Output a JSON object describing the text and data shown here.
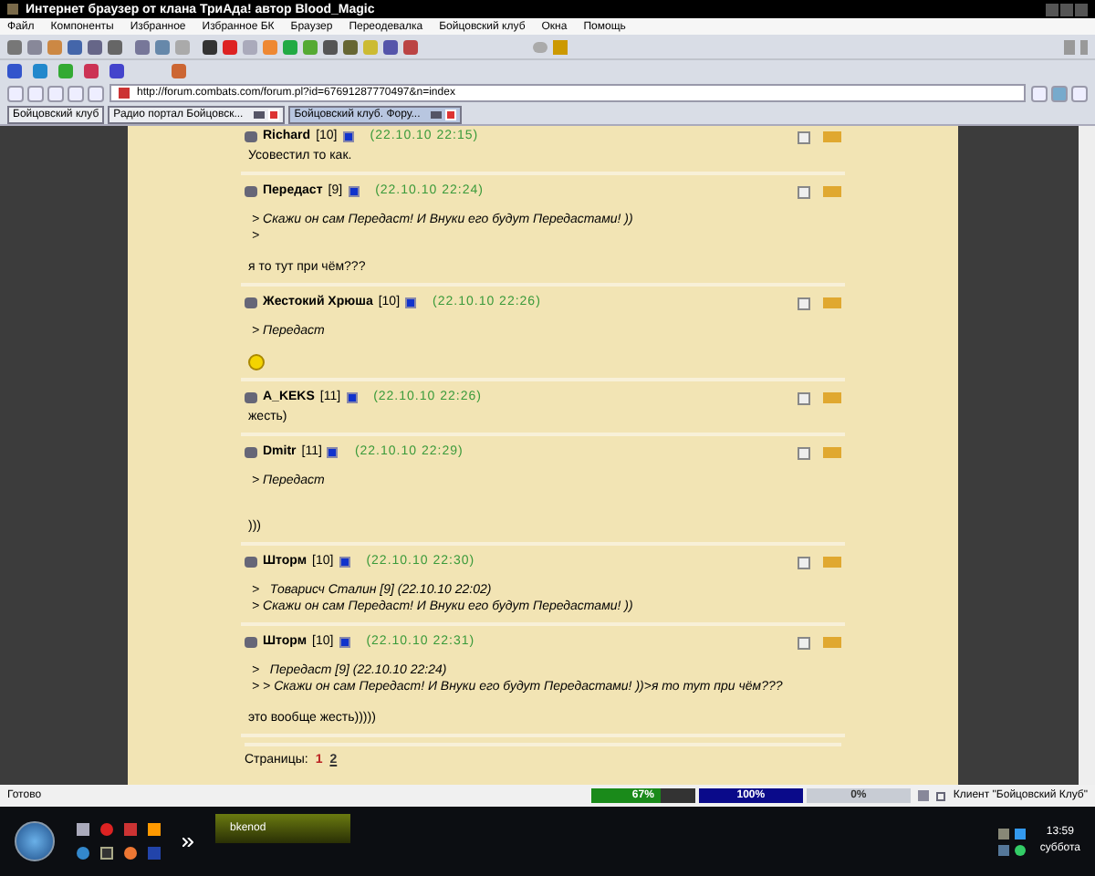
{
  "window": {
    "title": "Интернет браузер от клана ТриАда! автор Blood_Magic"
  },
  "menu": [
    "Файл",
    "Компоненты",
    "Избранное",
    "Избранное БК",
    "Браузер",
    "Переодевалка",
    "Бойцовский клуб",
    "Окна",
    "Помощь"
  ],
  "address": {
    "value": "http://forum.combats.com/forum.pl?id=67691287770497&n=index"
  },
  "tabs": [
    {
      "label": "Бойцовский клуб",
      "selected": false,
      "closable": false
    },
    {
      "label": "Радио портал Бойцовск...",
      "selected": false,
      "closable": true
    },
    {
      "label": "Бойцовский клуб. Фору...",
      "selected": true,
      "closable": true
    }
  ],
  "posts": [
    {
      "checked": false,
      "name": "Richard",
      "level": "[10]",
      "time": "(22.10.10 22:15)",
      "lines": [
        {
          "kind": "text",
          "text": "Усовестил то как."
        }
      ]
    },
    {
      "checked": false,
      "name": "Передаст",
      "level": "[9]",
      "time": "(22.10.10 22:24)",
      "lines": [
        {
          "kind": "quote",
          "text": "> Скажи он сам Передаст! И Внуки его будут Передастами! ))"
        },
        {
          "kind": "quote",
          "text": ">"
        },
        {
          "kind": "gap"
        },
        {
          "kind": "text",
          "text": "я то тут при чём???"
        }
      ]
    },
    {
      "checked": false,
      "name": "Жестокий Хрюша",
      "level": "[10]",
      "time": "(22.10.10 22:26)",
      "lines": [
        {
          "kind": "quote",
          "text": "> Передаст"
        },
        {
          "kind": "gap"
        },
        {
          "kind": "smiley"
        }
      ]
    },
    {
      "checked": false,
      "name": "A_KEKS",
      "level": "[11]",
      "time": "(22.10.10 22:26)",
      "lines": [
        {
          "kind": "text",
          "text": "жесть)"
        }
      ]
    },
    {
      "checked": false,
      "name": "Dmitr",
      "level": "[11]",
      "time": "(22.10.10 22:29)",
      "lines": [
        {
          "kind": "quote",
          "text": "> Передаст"
        },
        {
          "kind": "gap"
        },
        {
          "kind": "gap"
        },
        {
          "kind": "text",
          "text": ")))"
        }
      ]
    },
    {
      "checked": false,
      "name": "Шторм",
      "level": "[10]",
      "time": "(22.10.10 22:30)",
      "lines": [
        {
          "kind": "quote",
          "text": ">   Товарисч Сталин [9] (22.10.10 22:02)"
        },
        {
          "kind": "quote",
          "text": "> Скажи он сам Передаст! И Внуки его будут Передастами! ))"
        }
      ]
    },
    {
      "checked": false,
      "name": "Шторм",
      "level": "[10]",
      "time": "(22.10.10 22:31)",
      "lines": [
        {
          "kind": "quote",
          "text": ">   Передаст [9] (22.10.10 22:24)"
        },
        {
          "kind": "quote",
          "text": "> > Скажи он сам Передаст! И Внуки его будут Передастами! ))>я то тут при чём???"
        },
        {
          "kind": "gap"
        },
        {
          "kind": "text",
          "text": "это вообще жесть)))))"
        }
      ]
    }
  ],
  "pages": {
    "label": "Страницы:",
    "items": [
      {
        "text": "1",
        "selected": true
      },
      {
        "text": "2",
        "selected": false
      }
    ]
  },
  "status_bar": {
    "text": "Готово",
    "meters": [
      {
        "reading": "67%",
        "level": 0.67
      },
      {
        "reading": "100%",
        "level": 1
      },
      {
        "reading": "0%",
        "level": 0
      }
    ],
    "client": "Клиент \"Бойцовский Клуб\""
  },
  "taskbar": {
    "task": "bkenod",
    "time": "13:59",
    "day": "суббота"
  }
}
